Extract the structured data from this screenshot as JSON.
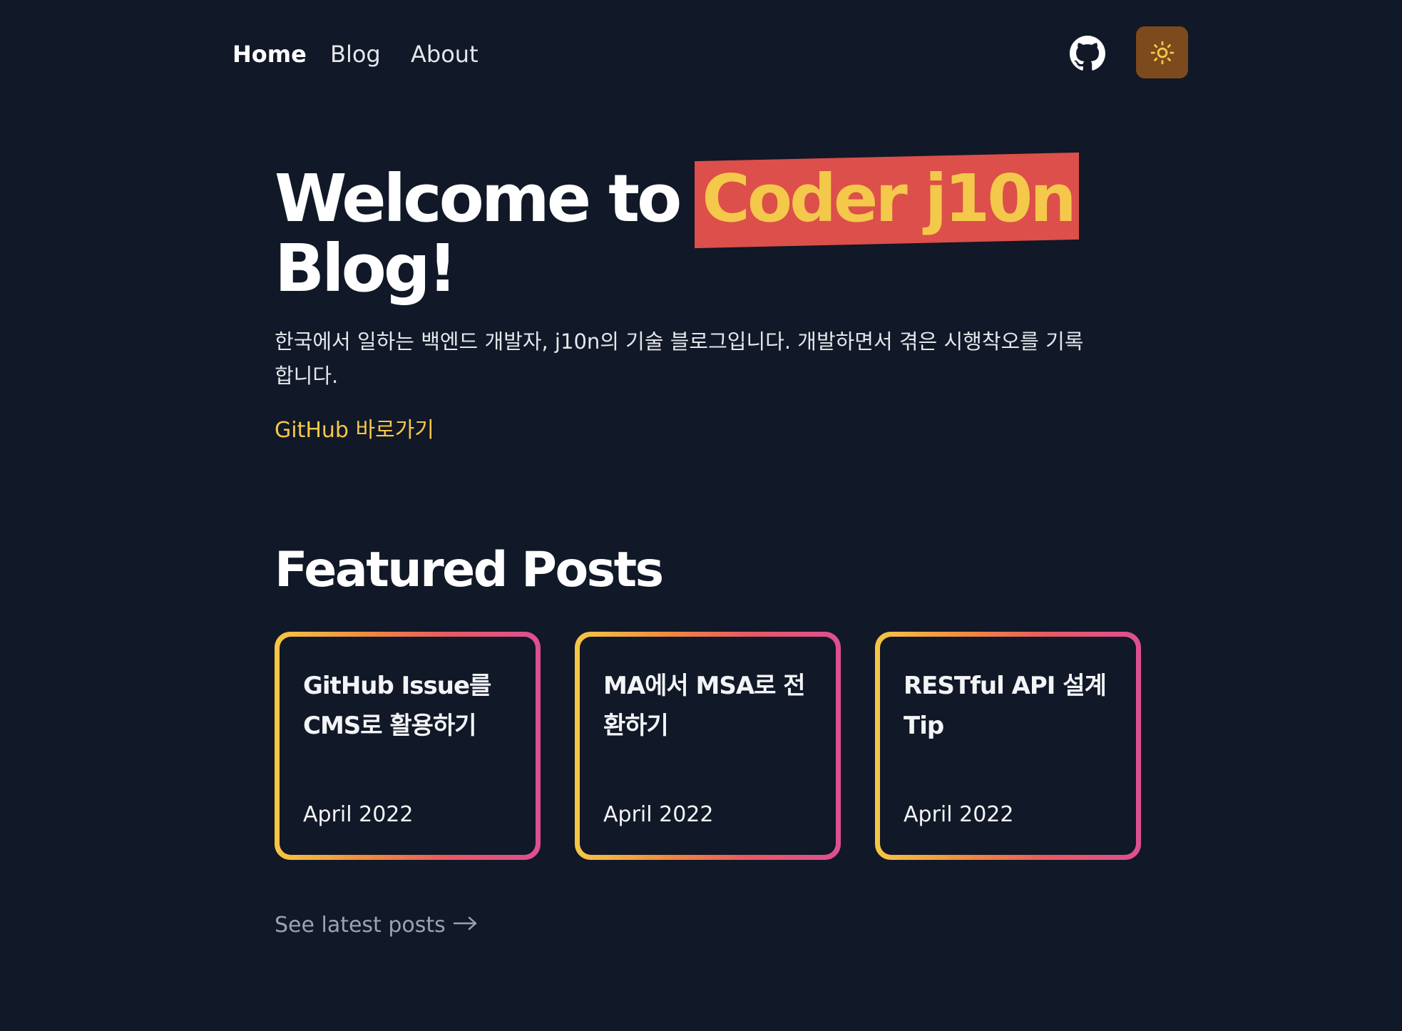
{
  "nav": {
    "links": [
      {
        "label": "Home",
        "active": true
      },
      {
        "label": "Blog",
        "active": false
      },
      {
        "label": "About",
        "active": false
      }
    ],
    "github_icon": "github-icon",
    "theme_icon": "sun-icon",
    "theme_button_color": "#7c4a1c"
  },
  "hero": {
    "title_prefix": "Welcome to",
    "title_highlight": "Coder j10n",
    "title_suffix": "Blog!",
    "description": "한국에서 일하는 백엔드 개발자, j10n의 기술 블로그입니다. 개발하면서 겪은 시행착오를 기록합니다.",
    "link_label": "GitHub 바로가기"
  },
  "featured": {
    "heading": "Featured Posts",
    "posts": [
      {
        "title": "GitHub Issue를 CMS로 활용하기",
        "date": "April 2022"
      },
      {
        "title": "MA에서 MSA로 전환하기",
        "date": "April 2022"
      },
      {
        "title": "RESTful API 설계 Tip",
        "date": "April 2022"
      }
    ],
    "see_latest_label": "See latest posts",
    "arrow_icon": "arrow-right-icon"
  },
  "colors": {
    "background": "#111827",
    "accent_yellow": "#f4c84a",
    "accent_red": "#dc4f4a",
    "gradient": [
      "#f5c746",
      "#ef8a3f",
      "#e75a62",
      "#dd4f93"
    ]
  }
}
